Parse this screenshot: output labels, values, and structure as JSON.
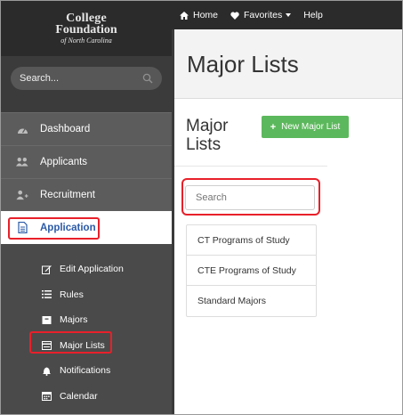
{
  "logo": {
    "line1": "College",
    "line2": "Foundation",
    "line3": "of North Carolina"
  },
  "sidebar_search": {
    "placeholder": "Search..."
  },
  "nav": [
    {
      "label": "Dashboard",
      "icon": "dashboard-icon"
    },
    {
      "label": "Applicants",
      "icon": "users-icon"
    },
    {
      "label": "Recruitment",
      "icon": "user-plus-icon"
    },
    {
      "label": "Application",
      "icon": "document-icon",
      "active": true
    }
  ],
  "subnav": [
    {
      "label": "Edit Application",
      "icon": "edit-icon"
    },
    {
      "label": "Rules",
      "icon": "list-icon"
    },
    {
      "label": "Majors",
      "icon": "box-icon"
    },
    {
      "label": "Major Lists",
      "icon": "card-icon"
    },
    {
      "label": "Notifications",
      "icon": "bell-icon"
    },
    {
      "label": "Calendar",
      "icon": "calendar-icon"
    }
  ],
  "topbar": {
    "home": "Home",
    "favorites": "Favorites",
    "help": "Help"
  },
  "page": {
    "title": "Major Lists",
    "panel_title_1": "Major",
    "panel_title_2": "Lists",
    "add_button": "New Major List",
    "search_placeholder": "Search"
  },
  "lists": [
    "CT Programs of Study",
    "CTE Programs of Study",
    "Standard Majors"
  ],
  "colors": {
    "accent_green": "#5cb85c",
    "active_blue": "#2b5aa6",
    "highlight_red": "#e8202a"
  }
}
